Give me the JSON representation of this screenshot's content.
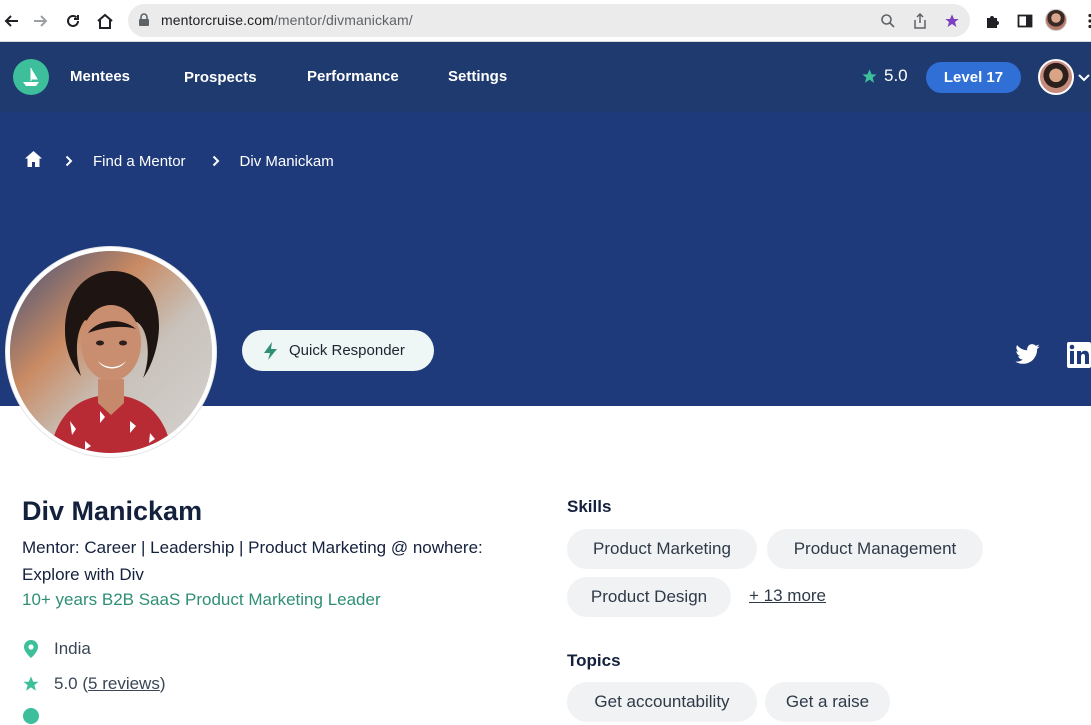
{
  "browser": {
    "url_host": "mentorcruise.com",
    "url_path": "/mentor/divmanickam/"
  },
  "navbar": {
    "links": [
      "Mentees",
      "Prospects",
      "Performance",
      "Settings"
    ],
    "rating": "5.0",
    "level": "Level 17"
  },
  "breadcrumb": {
    "items": [
      "Find a Mentor",
      "Div Manickam"
    ]
  },
  "hero": {
    "badge": "Quick Responder"
  },
  "profile": {
    "name": "Div Manickam",
    "headline": "Mentor: Career | Leadership | Product Marketing @ nowhere: Explore with Div",
    "tagline": "10+ years B2B SaaS Product Marketing Leader",
    "location": "India",
    "rating": "5.0",
    "reviews": "5 reviews"
  },
  "skills": {
    "title": "Skills",
    "items": [
      "Product Marketing",
      "Product Management",
      "Product Design"
    ],
    "more": "+ 13 more"
  },
  "topics": {
    "title": "Topics",
    "items": [
      "Get accountability",
      "Get a raise"
    ]
  },
  "colors": {
    "navbar": "#1f3a6e",
    "hero": "#1f3a7a",
    "accent_green": "#2f8f75",
    "level_badge": "#2f6fd6"
  }
}
